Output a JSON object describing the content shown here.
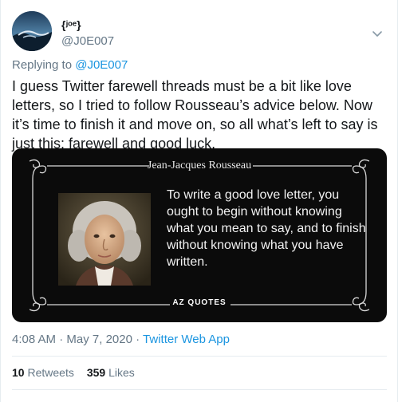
{
  "tweet": {
    "author": {
      "display_name": "{ʲᵒᵉ}",
      "handle": "@J0E007",
      "avatar_icon": "ocean-wave-avatar"
    },
    "menu_icon": "chevron-down-icon",
    "replying_prefix": "Replying to",
    "replying_to": "@J0E007",
    "text": "I guess Twitter farewell threads must be a bit like love letters, so I tried to follow Rousseau’s advice below. Now it’s time to finish it and move on, so all what’s left to say is just this: farewell and good luck.",
    "media": {
      "author": "Jean-Jacques Rousseau",
      "quote": "To write a good love letter, you ought to begin without knowing what you mean to say, and to finish without knowing what you have written.",
      "brand": "AZ QUOTES"
    },
    "time": "4:08 AM",
    "separator": "·",
    "date": "May 7, 2020",
    "source": "Twitter Web App",
    "stats": {
      "retweets_count": "10",
      "retweets_label": "Retweets",
      "likes_count": "359",
      "likes_label": "Likes"
    }
  },
  "colors": {
    "link": "#1b95e0",
    "secondary_text": "#657786",
    "primary_text": "#14171a",
    "media_background": "#0b0b0b"
  }
}
